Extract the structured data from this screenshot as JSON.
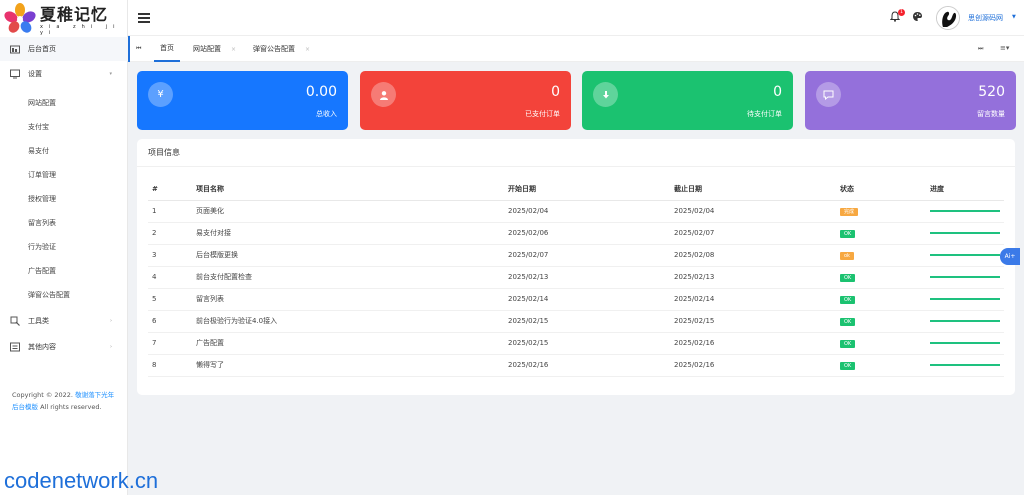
{
  "brand": {
    "logo_text": "夏稚记忆",
    "logo_sub": "xia zhi ji yi"
  },
  "sidebar": {
    "items": [
      {
        "label": "后台首页",
        "icon": "dashboard-icon"
      },
      {
        "label": "设置",
        "icon": "settings-icon"
      },
      {
        "label": "工具类",
        "icon": "tools-icon"
      },
      {
        "label": "其他内容",
        "icon": "content-icon"
      }
    ],
    "sub_items": [
      "网站配置",
      "支付宝",
      "易支付",
      "订单管理",
      "授权管理",
      "留言列表",
      "行为验证",
      "广告配置",
      "弹窗公告配置"
    ]
  },
  "footer": {
    "copyright_prefix": "Copyright © 2022.",
    "link_text": "敬谢落下光年后台模版",
    "suffix": "All rights reserved."
  },
  "header": {
    "notification_count": "1",
    "username": "思创源码网"
  },
  "tabs": [
    {
      "label": "首页"
    },
    {
      "label": "网站配置"
    },
    {
      "label": "弹窗公告配置"
    }
  ],
  "stats": [
    {
      "value": "0.00",
      "label": "总收入",
      "icon": "yen-icon",
      "color": "#1677ff"
    },
    {
      "value": "0",
      "label": "已支付订单",
      "icon": "user-icon",
      "color": "#f3433a"
    },
    {
      "value": "0",
      "label": "待支付订单",
      "icon": "download-icon",
      "color": "#1bc270"
    },
    {
      "value": "520",
      "label": "留言数量",
      "icon": "comment-icon",
      "color": "#9470db"
    }
  ],
  "panel": {
    "title": "项目信息",
    "columns": [
      "#",
      "项目名称",
      "开始日期",
      "截止日期",
      "状态",
      "进度"
    ],
    "rows": [
      {
        "no": "1",
        "name": "页面美化",
        "start": "2025/02/04",
        "end": "2025/02/04",
        "status": "完成",
        "status_color": "#f7a841",
        "progress": 1.0
      },
      {
        "no": "2",
        "name": "易支付对接",
        "start": "2025/02/06",
        "end": "2025/02/07",
        "status": "OK",
        "status_color": "#1bc270",
        "progress": 1.0
      },
      {
        "no": "3",
        "name": "后台模版更换",
        "start": "2025/02/07",
        "end": "2025/02/08",
        "status": "ok",
        "status_color": "#f7a841",
        "progress": 1.0
      },
      {
        "no": "4",
        "name": "前台支付配置检查",
        "start": "2025/02/13",
        "end": "2025/02/13",
        "status": "OK",
        "status_color": "#1bc270",
        "progress": 1.0
      },
      {
        "no": "5",
        "name": "留言列表",
        "start": "2025/02/14",
        "end": "2025/02/14",
        "status": "OK",
        "status_color": "#1bc270",
        "progress": 1.0
      },
      {
        "no": "6",
        "name": "前台极验行为验证4.0接入",
        "start": "2025/02/15",
        "end": "2025/02/15",
        "status": "OK",
        "status_color": "#1bc270",
        "progress": 1.0
      },
      {
        "no": "7",
        "name": "广告配置",
        "start": "2025/02/15",
        "end": "2025/02/16",
        "status": "OK",
        "status_color": "#1bc270",
        "progress": 1.0
      },
      {
        "no": "8",
        "name": "懒得写了",
        "start": "2025/02/16",
        "end": "2025/02/16",
        "status": "OK",
        "status_color": "#1bc270",
        "progress": 1.0
      }
    ]
  },
  "ai_button": "Ai+",
  "watermark": "codenetwork.cn"
}
